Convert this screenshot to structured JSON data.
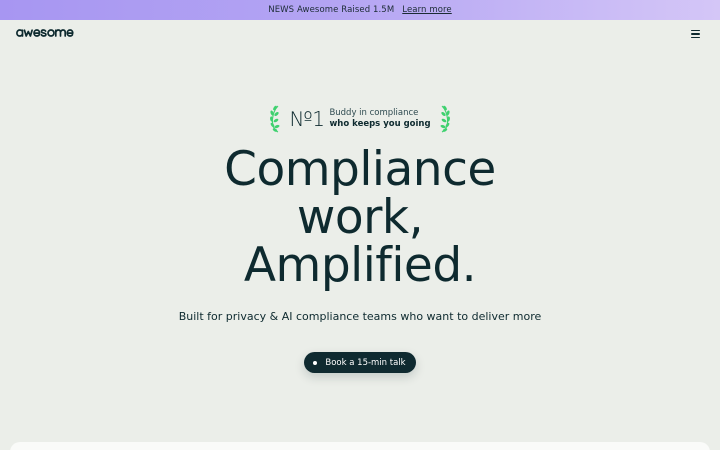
{
  "announcement": {
    "text": "NEWS Awesome Raised 1.5M",
    "link_label": "Learn more"
  },
  "nav": {
    "logo_text": "awesome",
    "menu_icon": "hamburger-icon"
  },
  "badge": {
    "rank": "№1",
    "line1": "Buddy in compliance",
    "line2": "who keeps you going",
    "laurel_color": "#3fd16f"
  },
  "hero": {
    "line1": "Compliance",
    "line2": "work,",
    "line3": "Amplified."
  },
  "subtitle": "Built for privacy & AI compliance teams who want to deliver more",
  "cta": {
    "label": "Book a 15-min talk"
  },
  "colors": {
    "background": "#ebeee9",
    "text": "#0e2a2f",
    "banner_start": "#a796f2",
    "banner_end": "#d4c6f7",
    "cta_bg": "#0f2a30"
  }
}
